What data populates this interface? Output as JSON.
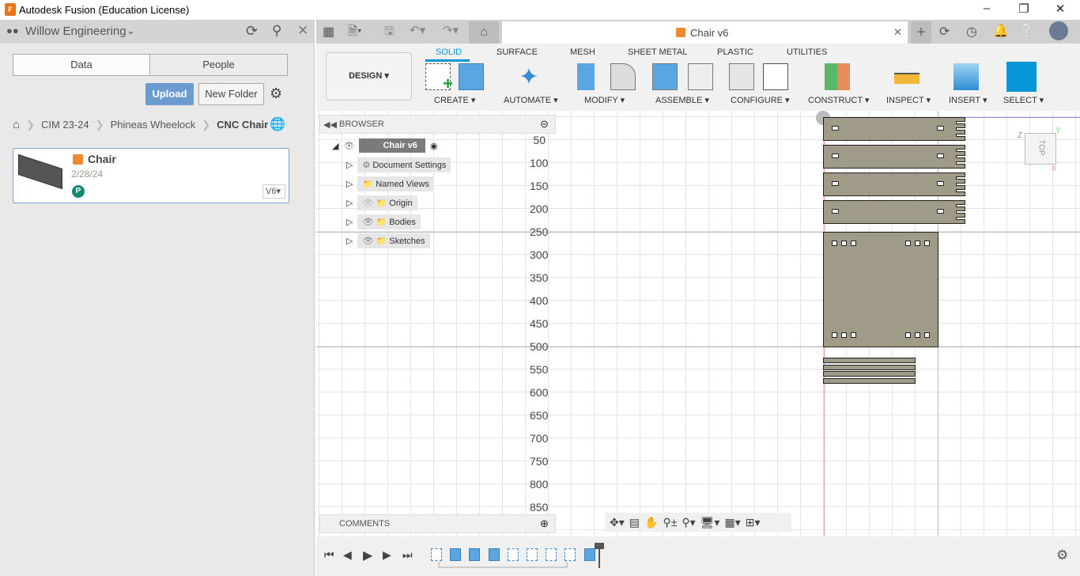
{
  "window": {
    "title": "Autodesk Fusion (Education License)",
    "logo_letter": "F"
  },
  "data_panel": {
    "team": "Willow Engineering",
    "tabs": [
      "Data",
      "People"
    ],
    "upload": "Upload",
    "new_folder": "New Folder",
    "breadcrumb": [
      "CIM 23-24",
      "Phineas Wheelock",
      "CNC Chair"
    ],
    "items": [
      {
        "name": "Chair",
        "date": "2/28/24",
        "user_initial": "P",
        "version": "V6"
      }
    ]
  },
  "document": {
    "tab_title": "Chair v6"
  },
  "ribbon": {
    "workspace": "DESIGN",
    "tabs": [
      "SOLID",
      "SURFACE",
      "MESH",
      "SHEET METAL",
      "PLASTIC",
      "UTILITIES"
    ],
    "active_tab": "SOLID",
    "groups": [
      "CREATE",
      "AUTOMATE",
      "MODIFY",
      "ASSEMBLE",
      "CONFIGURE",
      "CONSTRUCT",
      "INSPECT",
      "INSERT",
      "SELECT"
    ]
  },
  "browser": {
    "title": "BROWSER",
    "root": "Chair v6",
    "items": [
      "Document Settings",
      "Named Views",
      "Origin",
      "Bodies",
      "Sketches"
    ]
  },
  "comments": {
    "title": "COMMENTS"
  },
  "ruler": [
    "50",
    "100",
    "150",
    "200",
    "250",
    "300",
    "350",
    "400",
    "450",
    "500",
    "550",
    "600",
    "650",
    "700",
    "750",
    "800",
    "850"
  ],
  "viewcube": {
    "face": "TOP",
    "axes": [
      "Z",
      "Y",
      "X"
    ]
  },
  "timeline": {
    "features": [
      "sketch",
      "extrude",
      "extrude",
      "extrude",
      "sketch",
      "sketch",
      "sketch",
      "sketch",
      "extrude"
    ]
  },
  "colors": {
    "accent": "#0696d7",
    "upload": "#6b9bcf",
    "part": "#a09a89",
    "user_badge": "#138a72"
  }
}
